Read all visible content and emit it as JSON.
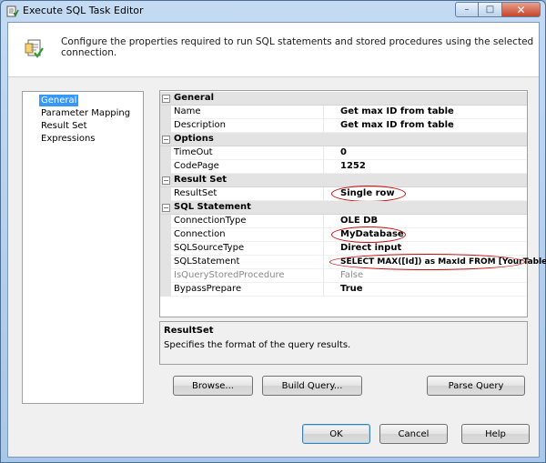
{
  "window": {
    "title": "Execute SQL Task Editor",
    "controls": {
      "minimize": "–",
      "maximize": "□",
      "close": "✕"
    }
  },
  "header": {
    "description": "Configure the properties required to run SQL statements and stored procedures using the selected connection."
  },
  "nav": {
    "items": [
      {
        "label": "General",
        "selected": true
      },
      {
        "label": "Parameter Mapping",
        "selected": false
      },
      {
        "label": "Result Set",
        "selected": false
      },
      {
        "label": "Expressions",
        "selected": false
      }
    ]
  },
  "grid": {
    "categories": [
      {
        "label": "General",
        "expander": "⊟",
        "properties": [
          {
            "name": "Name",
            "value": "Get max ID from table"
          },
          {
            "name": "Description",
            "value": "Get max ID from table"
          }
        ]
      },
      {
        "label": "Options",
        "expander": "⊟",
        "properties": [
          {
            "name": "TimeOut",
            "value": "0"
          },
          {
            "name": "CodePage",
            "value": "1252"
          }
        ]
      },
      {
        "label": "Result Set",
        "expander": "⊟",
        "properties": [
          {
            "name": "ResultSet",
            "value": "Single row",
            "highlighted": true
          }
        ]
      },
      {
        "label": "SQL Statement",
        "expander": "⊟",
        "properties": [
          {
            "name": "ConnectionType",
            "value": "OLE DB"
          },
          {
            "name": "Connection",
            "value": "MyDatabase",
            "highlighted": true
          },
          {
            "name": "SQLSourceType",
            "value": "Direct input"
          },
          {
            "name": "SQLStatement",
            "value": "SELECT MAX([Id]) as MaxId FROM [YourTable]",
            "highlighted": true
          },
          {
            "name": "IsQueryStoredProcedure",
            "value": "False",
            "disabled": true
          },
          {
            "name": "BypassPrepare",
            "value": "True"
          }
        ]
      }
    ],
    "highlight_color": "#cc1010"
  },
  "description_panel": {
    "title": "ResultSet",
    "text": "Specifies the format of the query results."
  },
  "actions": {
    "browse": "Browse...",
    "build_query": "Build Query...",
    "parse_query": "Parse Query"
  },
  "footer": {
    "ok": "OK",
    "cancel": "Cancel",
    "help": "Help"
  }
}
